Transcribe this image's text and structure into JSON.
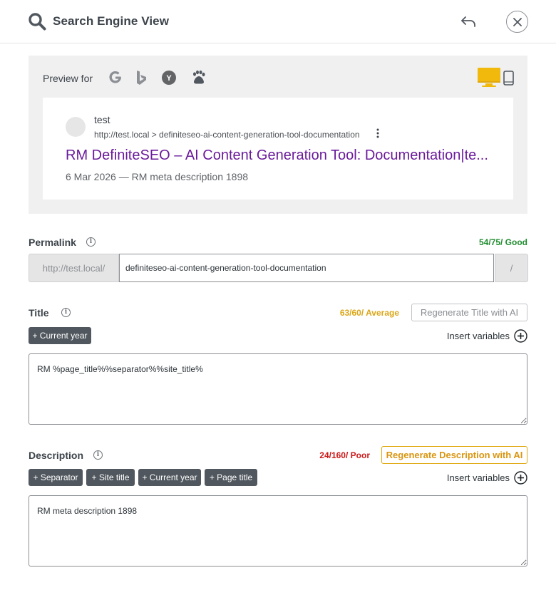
{
  "header": {
    "title": "Search Engine View",
    "search_icon": "search-icon",
    "undo_icon": "undo-arrow-icon",
    "close_icon": "close-icon"
  },
  "preview": {
    "label": "Preview for",
    "engines": [
      {
        "name": "google-icon",
        "glyph": "G"
      },
      {
        "name": "bing-icon",
        "glyph": "b"
      },
      {
        "name": "yahoo-icon",
        "glyph": "Y"
      },
      {
        "name": "baidu-icon",
        "glyph": "paw"
      }
    ],
    "devices": {
      "desktop": "desktop-icon",
      "mobile": "mobile-icon",
      "selected": "desktop"
    },
    "serp": {
      "site_name": "test",
      "url": "http://test.local > definiteseo-ai-content-generation-tool-documentation",
      "title": "RM DefiniteSEO – AI Content Generation Tool: Documentation|te...",
      "date": "6 Mar 2026",
      "separator": "—",
      "description": "RM meta description 1898"
    }
  },
  "permalink": {
    "label": "Permalink",
    "score": "54/75/ Good",
    "prefix": "http://test.local/",
    "value": "definiteseo-ai-content-generation-tool-documentation",
    "suffix": "/"
  },
  "title_section": {
    "label": "Title",
    "score": "63/60/ Average",
    "ai_button": "Regenerate Title with AI",
    "variables": [
      "+ Current year"
    ],
    "insert_variables": "Insert variables",
    "value": "RM %page_title%%separator%%site_title%"
  },
  "description_section": {
    "label": "Description",
    "score": "24/160/ Poor",
    "ai_button": "Regenerate Description with AI",
    "variables": [
      "+ Separator",
      "+ Site title",
      "+ Current year",
      "+ Page title"
    ],
    "insert_variables": "Insert variables",
    "value": "RM meta description 1898"
  },
  "colors": {
    "accent_purple": "#6a1b9a",
    "good": "#1e8c2e",
    "average": "#dba617",
    "poor": "#cc1818",
    "ai_orange": "#d99510",
    "desktop_selected": "#f0b90b"
  }
}
